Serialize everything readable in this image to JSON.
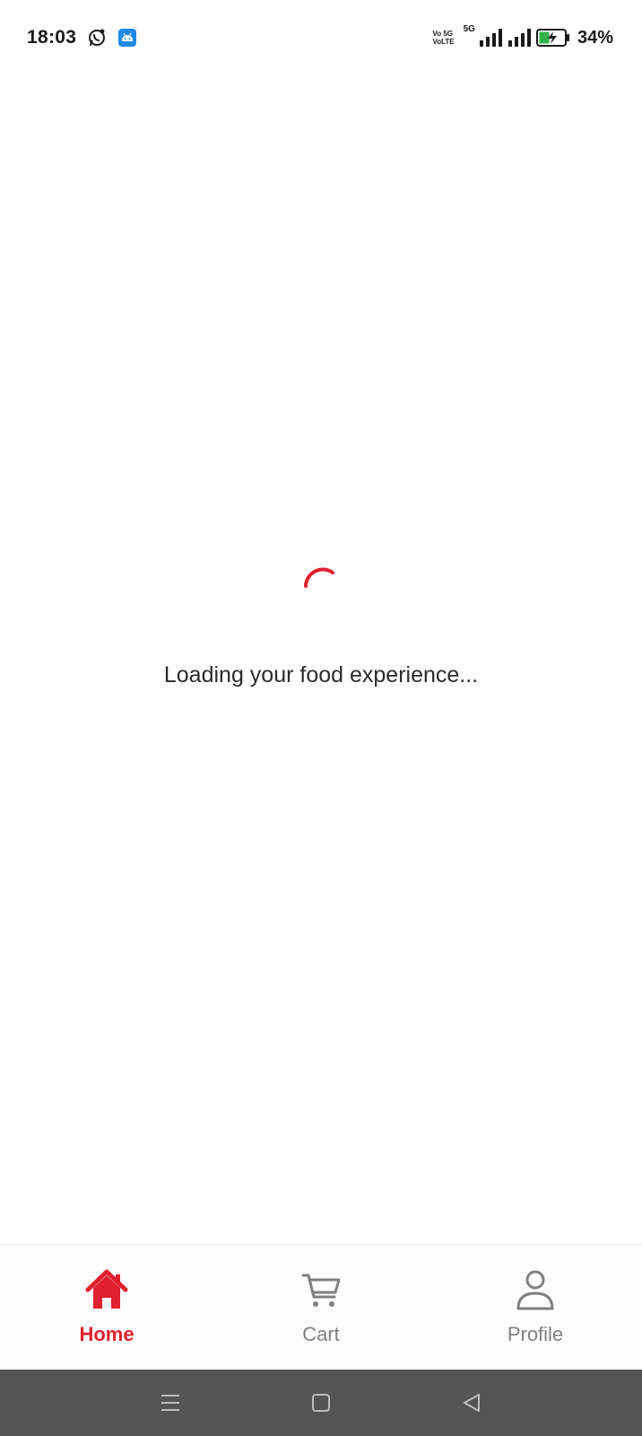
{
  "status_bar": {
    "time": "18:03",
    "volte_top": "Vo 5G",
    "volte_bottom": "VoLTE",
    "network": "5G",
    "battery": "34%",
    "icons": [
      "whatsapp-icon",
      "android-debug-icon",
      "signal-icon",
      "battery-charging-icon"
    ]
  },
  "loader": {
    "message": "Loading your food experience...",
    "accent_color": "#e0202e"
  },
  "bottom_nav": {
    "items": [
      {
        "label": "Home",
        "icon": "home-icon",
        "active": true
      },
      {
        "label": "Cart",
        "icon": "cart-icon",
        "active": false
      },
      {
        "label": "Profile",
        "icon": "profile-icon",
        "active": false
      }
    ]
  },
  "system_nav": {
    "icons": [
      "menu-icon",
      "home-square-icon",
      "back-triangle-icon"
    ]
  }
}
